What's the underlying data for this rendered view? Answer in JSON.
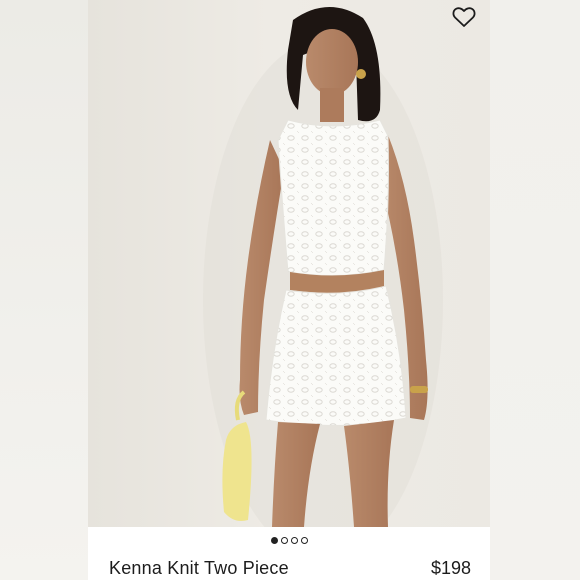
{
  "product": {
    "name": "Kenna Knit Two Piece",
    "price": "$198",
    "image": {
      "alt": "Kenna Knit Two Piece"
    },
    "favorite_icon": "heart-outline-icon"
  },
  "carousel": {
    "total_images": 4,
    "active_index": 0
  },
  "colors": {
    "text": "#1c1c1c",
    "dot": "#222222",
    "card": "#ffffff",
    "backdrop": "#f3f2ee"
  }
}
